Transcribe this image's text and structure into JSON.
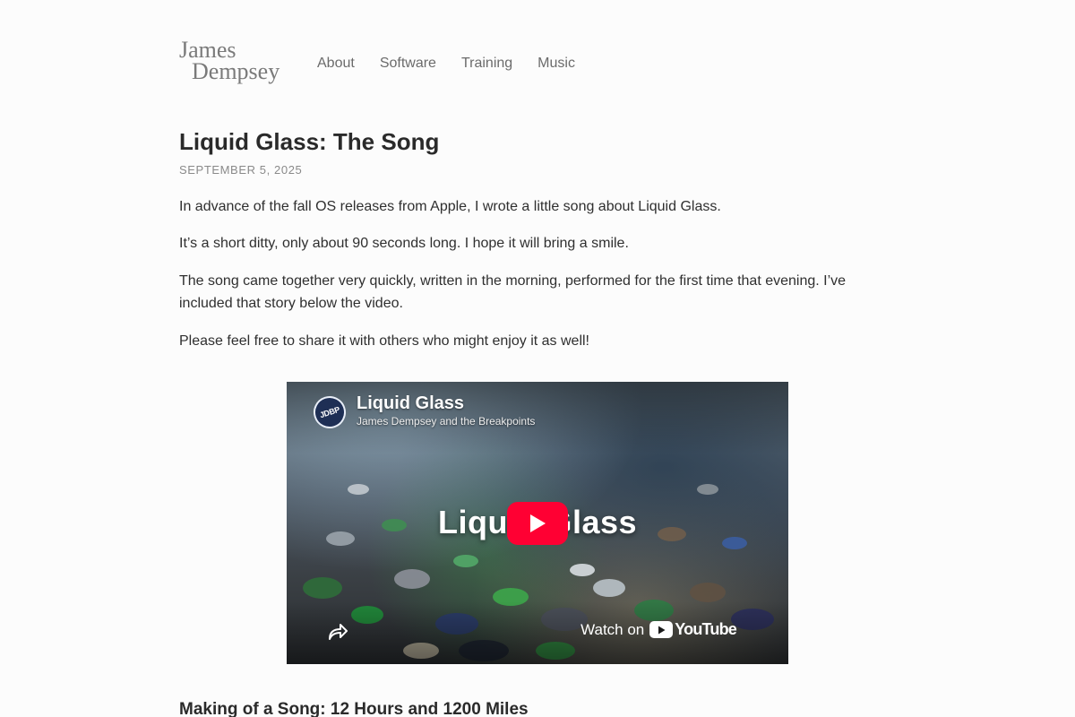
{
  "site": {
    "logo_line1": "James",
    "logo_line2": "Dempsey"
  },
  "nav": {
    "items": [
      {
        "label": "About"
      },
      {
        "label": "Software"
      },
      {
        "label": "Training"
      },
      {
        "label": "Music"
      }
    ]
  },
  "post": {
    "title": "Liquid Glass: The Song",
    "date": "SEPTEMBER 5, 2025",
    "paragraphs": [
      "In advance of the fall OS releases from Apple, I wrote a little song about Liquid Glass.",
      "It’s a short ditty, only about 90 seconds long. I hope it will bring a smile.",
      "The song came together very quickly, written in the morning, performed for the first time that evening. I’ve included that story below the video.",
      "Please feel free to share it with others who might enjoy it as well!"
    ],
    "section_heading": "Making of a Song: 12 Hours and 1200 Miles"
  },
  "video": {
    "title": "Liquid Glass",
    "channel": "James Dempsey and the Breakpoints",
    "avatar_text": "JDBP",
    "thumbnail_text": "Liquid Glass",
    "watch_on": "Watch on",
    "youtube_word": "YouTube",
    "play_color": "#ff0033"
  }
}
